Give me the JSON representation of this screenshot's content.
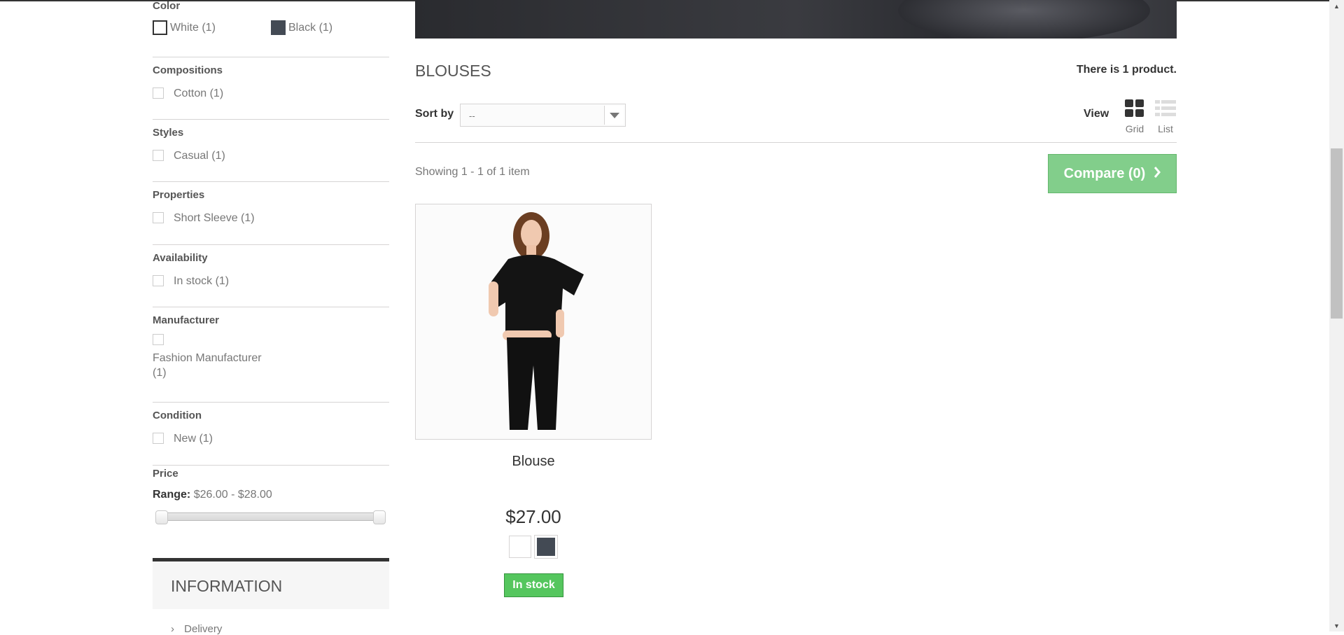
{
  "filters": {
    "color": {
      "title": "Color",
      "items": [
        {
          "label": "White (1)",
          "swatch": "#ffffff"
        },
        {
          "label": "Black (1)",
          "swatch": "#434a54"
        }
      ]
    },
    "compositions": {
      "title": "Compositions",
      "items": [
        {
          "label": "Cotton (1)"
        }
      ]
    },
    "styles": {
      "title": "Styles",
      "items": [
        {
          "label": "Casual (1)"
        }
      ]
    },
    "properties": {
      "title": "Properties",
      "items": [
        {
          "label": "Short Sleeve (1)"
        }
      ]
    },
    "availability": {
      "title": "Availability",
      "items": [
        {
          "label": "In stock (1)"
        }
      ]
    },
    "manufacturer": {
      "title": "Manufacturer",
      "items": [
        {
          "label_line1": "Fashion Manufacturer",
          "label_line2": "(1)"
        }
      ]
    },
    "condition": {
      "title": "Condition",
      "items": [
        {
          "label": "New (1)"
        }
      ]
    },
    "price": {
      "title": "Price",
      "range_label": "Range:",
      "range_value": "$26.00 - $28.00",
      "min": 26,
      "max": 28
    }
  },
  "information": {
    "title": "INFORMATION",
    "first_link": "Delivery"
  },
  "category": {
    "title": "BLOUSES",
    "count_text": "There is 1 product."
  },
  "toolbar": {
    "sort_label": "Sort by",
    "sort_value": "--",
    "view_label": "View",
    "view_grid": "Grid",
    "view_list": "List",
    "showing_text": "Showing 1 - 1 of 1 item",
    "compare_label": "Compare (0)"
  },
  "product": {
    "name": "Blouse",
    "price": "$27.00",
    "colors": [
      "#ffffff",
      "#434a54"
    ],
    "availability": "In stock"
  },
  "colors": {
    "accent_green": "#55c65e",
    "compare_green": "#7ccc85",
    "text_dark": "#333333",
    "text_muted": "#777777"
  }
}
